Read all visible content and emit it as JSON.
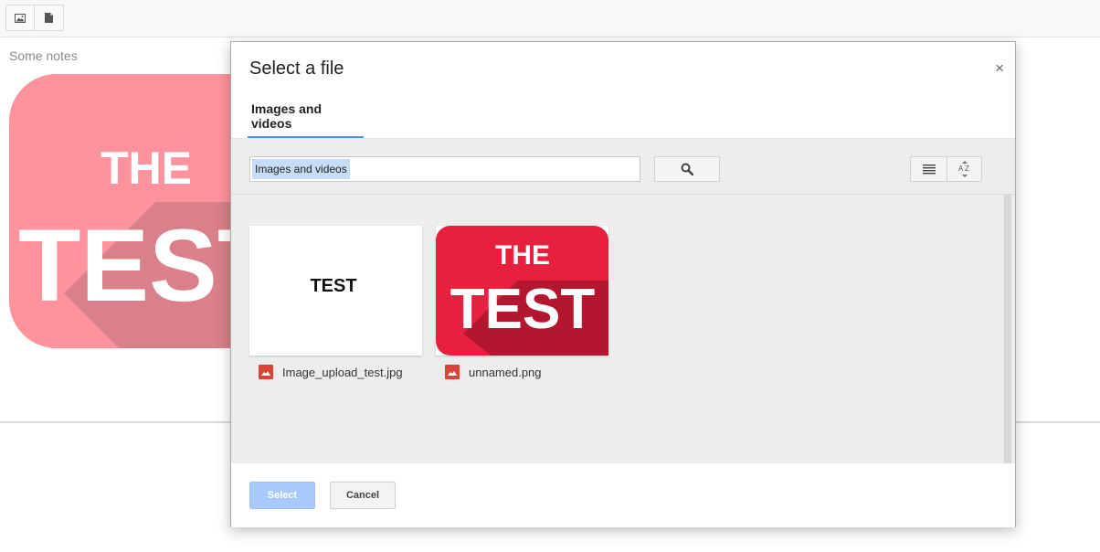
{
  "toolbar": {
    "buttons": [
      {
        "icon": "insert-image-icon"
      },
      {
        "icon": "insert-file-icon"
      }
    ]
  },
  "editor": {
    "notes_text": "Some notes",
    "image_title": "THE",
    "image_main": "TEST",
    "image_bg": "#ff939d"
  },
  "dialog": {
    "title": "Select a file",
    "close_glyph": "×",
    "tab_label": "Images and videos",
    "search_value": "Images and videos",
    "files": [
      {
        "name": "Image_upload_test.jpg",
        "thumb_text": "TEST"
      },
      {
        "name": "unnamed.png",
        "thumb_title": "THE",
        "thumb_main": "TEST"
      }
    ],
    "select_label": "Select",
    "cancel_label": "Cancel"
  },
  "colors": {
    "accent": "#4d90fe",
    "select_disabled": "#a8c9fb",
    "file_icon": "#db4437",
    "thumb_red": "#e8203f"
  }
}
